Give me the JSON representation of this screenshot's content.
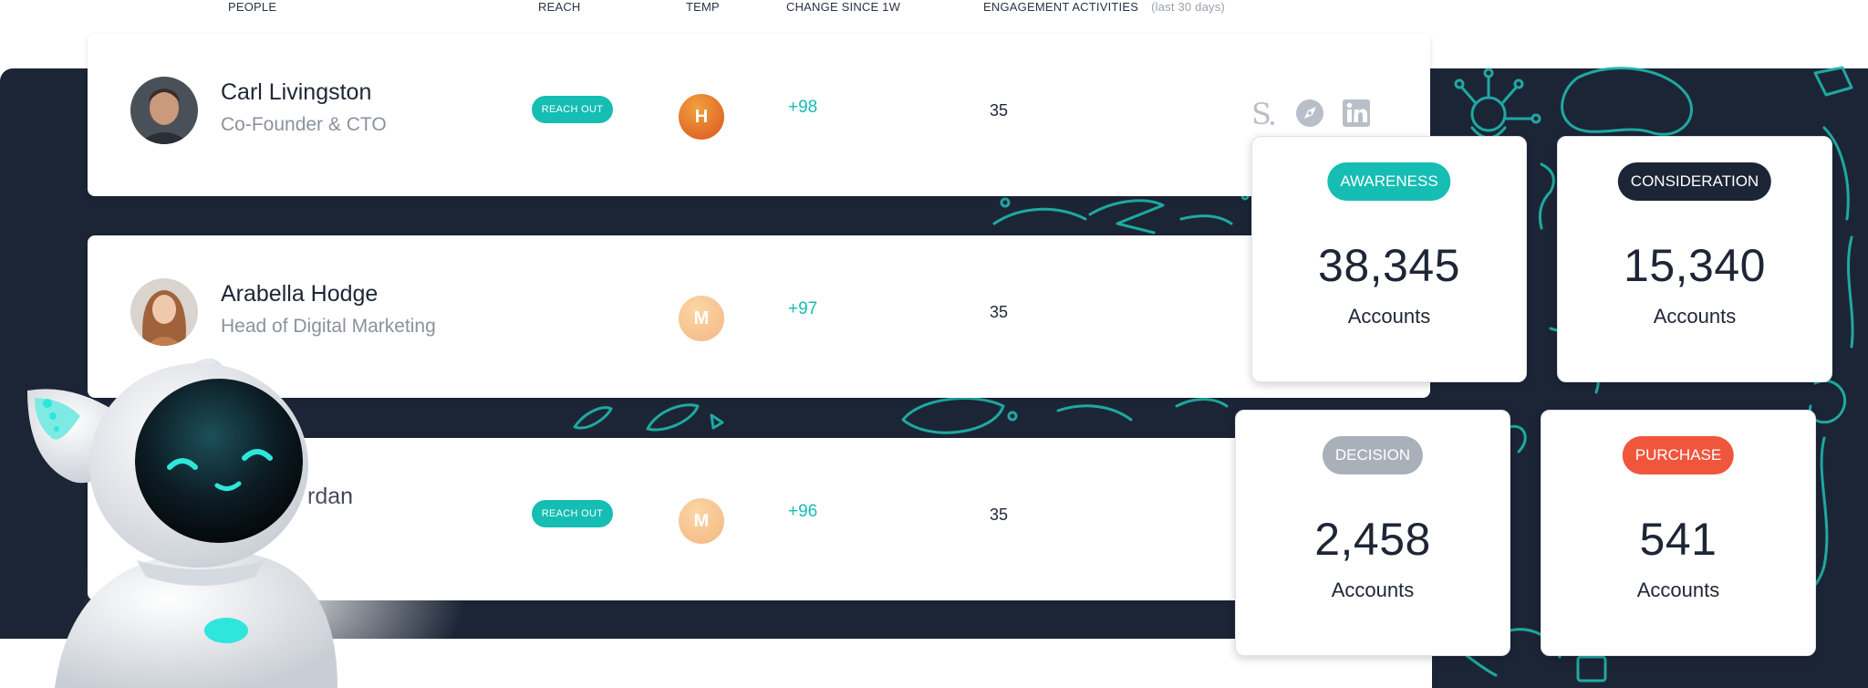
{
  "headers": {
    "people": "PEOPLE",
    "reach": "REACH",
    "temp": "TEMP",
    "change": "CHANGE SINCE 1W",
    "engagement": "ENGAGEMENT ACTIVITIES",
    "engagement_sub": "(last 30 days)"
  },
  "rows": [
    {
      "name": "Carl Livingston",
      "title": "Co-Founder & CTO",
      "reach": "REACH OUT",
      "temp": "H",
      "change": "+98",
      "engagement": "35"
    },
    {
      "name": "Arabella Hodge",
      "title": "Head of Digital Marketing",
      "reach": "",
      "temp": "M",
      "change": "+97",
      "engagement": "35"
    },
    {
      "name": "rdan",
      "title": "",
      "reach": "REACH OUT",
      "temp": "M",
      "change": "+96",
      "engagement": "35"
    }
  ],
  "social_icons": [
    "salesloft-s-icon",
    "compass-icon",
    "linkedin-icon"
  ],
  "stages": [
    {
      "label": "AWARENESS",
      "value": "38,345",
      "unit": "Accounts",
      "color": "#15bdb3"
    },
    {
      "label": "CONSIDERATION",
      "value": "15,340",
      "unit": "Accounts",
      "color": "#1c2536"
    },
    {
      "label": "DECISION",
      "value": "2,458",
      "unit": "Accounts",
      "color": "#a9b0ba"
    },
    {
      "label": "PURCHASE",
      "value": "541",
      "unit": "Accounts",
      "color": "#f0563c"
    }
  ],
  "colors": {
    "accent": "#15bdb3",
    "dark": "#1c2536",
    "text": "#1e2636",
    "muted": "#8b929c",
    "purchase": "#f0563c"
  }
}
